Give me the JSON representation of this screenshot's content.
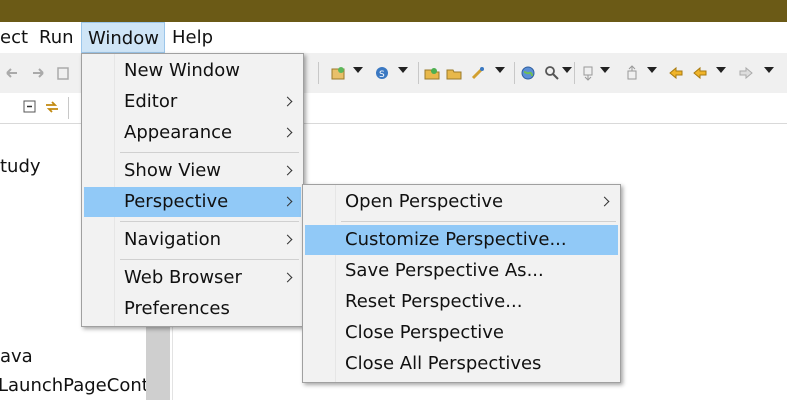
{
  "menubar": {
    "items": [
      "ect",
      "Run",
      "Window",
      "Help"
    ],
    "active": "Window"
  },
  "tree": {
    "items": [
      "tudy",
      "ava",
      "LaunchPageContr"
    ]
  },
  "window_menu": {
    "items": [
      {
        "label": "New Window",
        "submenu": false
      },
      {
        "label": "Editor",
        "submenu": true
      },
      {
        "label": "Appearance",
        "submenu": true
      },
      {
        "label": "Show View",
        "submenu": true
      },
      {
        "label": "Perspective",
        "submenu": true,
        "highlighted": true
      },
      {
        "label": "Navigation",
        "submenu": true
      },
      {
        "label": "Web Browser",
        "submenu": true
      },
      {
        "label": "Preferences",
        "submenu": false
      }
    ]
  },
  "perspective_menu": {
    "items": [
      {
        "label": "Open Perspective",
        "submenu": true
      },
      {
        "label": "Customize Perspective...",
        "highlighted": true
      },
      {
        "label": "Save Perspective As..."
      },
      {
        "label": "Reset Perspective..."
      },
      {
        "label": "Close Perspective"
      },
      {
        "label": "Close All Perspectives"
      }
    ]
  },
  "colors": {
    "titlebar": "#6b5a16",
    "highlight": "#91c9f7",
    "menu_bg": "#f2f2f2"
  }
}
